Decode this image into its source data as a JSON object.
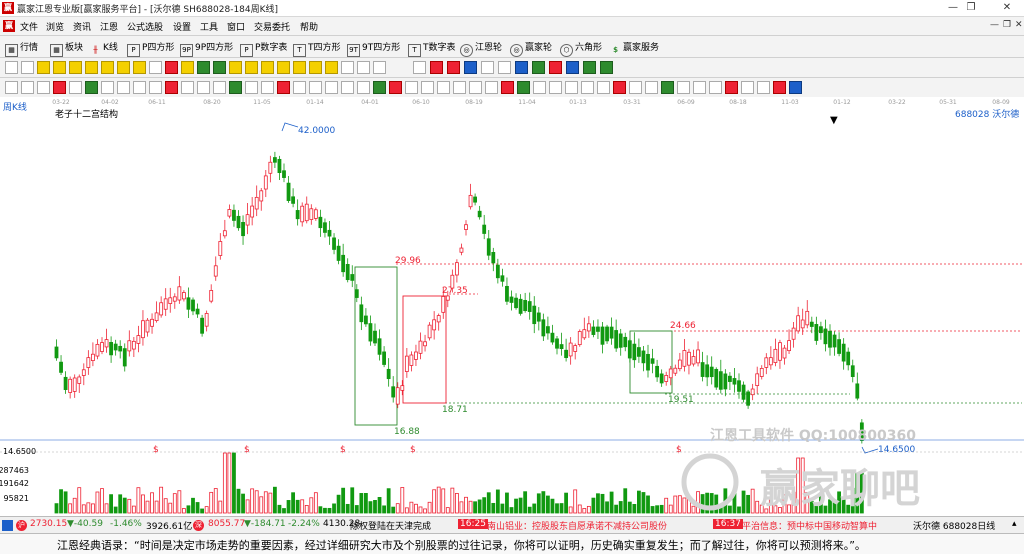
{
  "window": {
    "title": "赢家江恩专业版[赢家服务平台] - [沃尔德  SH688028-184周K线]",
    "min_icon": "minimize-icon",
    "max_icon": "restore-icon",
    "close_icon": "close-icon"
  },
  "menu": [
    "文件",
    "浏览",
    "资讯",
    "江恩",
    "公式选股",
    "设置",
    "工具",
    "窗口",
    "交易委托",
    "帮助"
  ],
  "nav": [
    "行情",
    "板块",
    "K线",
    "P四方形",
    "9P四方形",
    "P数字表",
    "T四方形",
    "9T四方形",
    "T数字表",
    "江恩轮",
    "赢家轮",
    "六角形",
    "赢家服务"
  ],
  "chart": {
    "period_label": "周K线",
    "structure_label": "老子十二宫结构",
    "code_label": "688028  沃尔德",
    "date_ticks": [
      "03-22",
      "04-02",
      "06-11",
      "08-20",
      "11-05",
      "01-14",
      "04-01",
      "06-10",
      "08-19",
      "11-04",
      "01-13",
      "03-31",
      "06-09",
      "08-18",
      "11-03",
      "01-12",
      "03-22",
      "05-31",
      "08-09"
    ],
    "price_labels": {
      "high": "42.0000",
      "low": "14.6500",
      "left_axis": "14.6500"
    },
    "levels": [
      {
        "label": "29.96",
        "color": "#e23"
      },
      {
        "label": "27.35",
        "color": "#e23"
      },
      {
        "label": "24.66",
        "color": "#e23"
      },
      {
        "label": "19.51",
        "color": "#2e8b2e"
      },
      {
        "label": "18.71",
        "color": "#2e8b2e"
      },
      {
        "label": "16.88",
        "color": "#2e8b2e"
      }
    ],
    "dollar_mark": "$",
    "volume_ticks": [
      "287463",
      "191642",
      "95821"
    ],
    "watermark_1": "江恩工具软件  QQ:100800360",
    "watermark_2": "赢家聊吧"
  },
  "status": {
    "index1_value": "2730.15",
    "index1_change": "▼-40.59",
    "index1_pct": "-1.46%",
    "index1_amount": "3926.61亿",
    "index2_value": "8055.77",
    "index2_change": "▼-184.71",
    "index2_pct": "-2.24%",
    "index2_amount": "4130.28",
    "news1": "除权登陆在天津完成",
    "news2_time": "16:25",
    "news2": "南山铝业：控股股东自愿承诺不减持公司股份",
    "news3_time": "16:37",
    "news3": "平治信息：预中标中国移动智算中",
    "right": "沃尔德 688028日线"
  },
  "quote": "江恩经典语录：“时间是决定市场走势的重要因素，经过详细研究大市及个别股票的过往记录，你将可以证明，历史确实重复发生；而了解过往，你将可以预测将来。”。"
}
